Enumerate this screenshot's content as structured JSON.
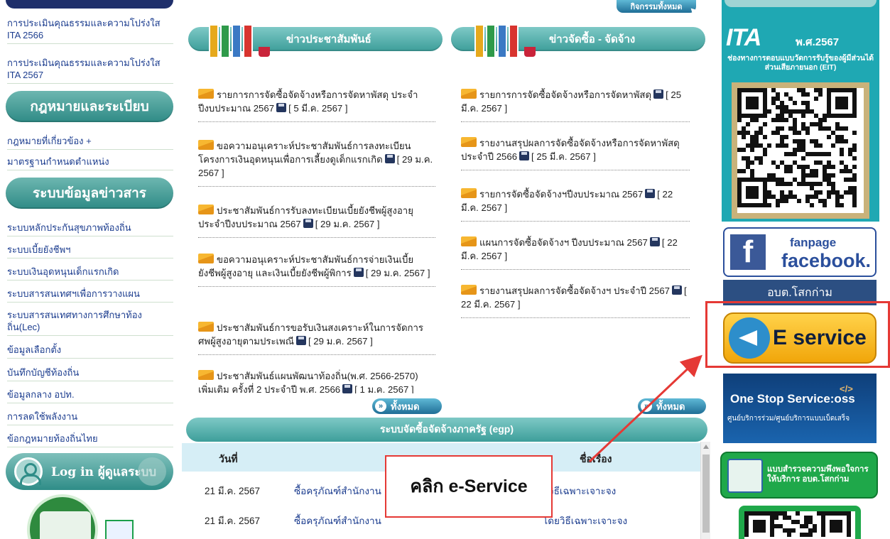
{
  "left": {
    "links_top": [
      "การประเมินคุณธรรมและความโปร่งใส ITA 2566",
      "การประเมินคุณธรรมและความโปร่งใส ITA 2567"
    ],
    "section_law": "กฎหมายและระเบียบ",
    "links_law": [
      "กฎหมายที่เกี่ยวข้อง +",
      "มาตรฐานกำหนดตำแหน่ง"
    ],
    "section_info": "ระบบข้อมูลข่าวสาร",
    "links_info": [
      "ระบบหลักประกันสุขภาพท้องถิ่น",
      "ระบบเบี้ยยังชีพฯ",
      "ระบบเงินอุดหนุนเด็กแรกเกิด",
      "ระบบสารสนเทศฯเพื่อการวางแผน",
      "ระบบสารสนเทศทางการศึกษาท้องถิ่น(Lec)",
      "ข้อมูลเลือกตั้ง",
      "บันทึกบัญชีท้องถิ่น",
      "ข้อมูลกลาง อปท.",
      "การลดใช้พลังงาน",
      "ข้อกฎหมายท้องถิ่นไทย"
    ],
    "login_label": "Log in ผู้ดูแลระบบ"
  },
  "top_pill": "กิจกรรมทั้งหมด",
  "pr": {
    "title": "ข่าวประชาสัมพันธ์",
    "items": [
      {
        "text": "รายการการจัดซื้อจัดจ้างหรือการจัดหาพัสดุ ประจำปีงบประมาณ 2567",
        "date": "[ 5 มี.ค. 2567 ]"
      },
      {
        "text": "ขอความอนุเคราะห์ประชาสัมพันธ์การลงทะเบียนโครงการเงินอุดหนุนเพื่อการเลี้ยงดูเด็กแรกเกิด",
        "date": "[ 29 ม.ค. 2567 ]"
      },
      {
        "text": "ประชาสัมพันธ์การรับลงทะเบียนเบี้ยยังชีพผู้สูงอายุประจำปีงบประมาณ 2567",
        "date": "[ 29 ม.ค. 2567 ]"
      },
      {
        "text": "ขอความอนุเคราะห์ประชาสัมพันธ์การจ่ายเงินเบี้ยยังชีพผู้สูงอายุ และเงินเบี้ยยังชีพผู้พิการ",
        "date": "[ 29 ม.ค. 2567 ]"
      },
      {
        "text": "ประชาสัมพันธ์การขอรับเงินสงเคราะห์ในการจัดการศพผู้สูงอายุตามประเพณี",
        "date": "[ 29 ม.ค. 2567 ]"
      },
      {
        "text": "ประชาสัมพันธ์แผนพัฒนาท้องถิ่น(พ.ศ. 2566-2570) เพิ่มเติม ครั้งที่ 2 ประจำปี พ.ศ. 2566",
        "date": "[ 1 ม.ค. 2567 ]"
      }
    ],
    "all_label": "ทั้งหมด"
  },
  "procure": {
    "title": "ข่าวจัดซื้อ - จัดจ้าง",
    "items": [
      {
        "text": "รายการการจัดซื้อจัดจ้างหรือการจัดหาพัสดุ",
        "date": "[ 25 มี.ค. 2567 ]"
      },
      {
        "text": "รายงานสรุปผลการจัดซื้อจัดจ้างหรือการจัดหาพัสดุ ประจำปี 2566",
        "date": "[ 25 มี.ค. 2567 ]"
      },
      {
        "text": "รายการจัดซื้อจัดจ้างฯปีงบประมาณ 2567",
        "date": "[ 22 มี.ค. 2567 ]"
      },
      {
        "text": "แผนการจัดซื้อจัดจ้างฯ ปีงบประมาณ 2567",
        "date": "[ 22 มี.ค. 2567 ]"
      },
      {
        "text": "รายงานสรุปผลการจัดซื้อจัดจ้างฯ ประจำปี 2567",
        "date": "[ 22 มี.ค. 2567 ]"
      }
    ],
    "all_label": "ทั้งหมด"
  },
  "egp": {
    "title": "ระบบจัดซื้อจัดจ้างภาครัฐ (egp)",
    "col_date": "วันที่",
    "col_title": "ชื่อเรื่อง",
    "rows": [
      {
        "date": "21 มี.ค. 2567",
        "title": "ซื้อครุภัณฑ์สำนักงาน",
        "method": "วิธีเฉพาะเจาะจง"
      },
      {
        "date": "21 มี.ค. 2567",
        "title": "ซื้อครุภัณฑ์สำนักงาน",
        "method": "โดยวิธีเฉพาะเจาะจง"
      }
    ]
  },
  "callout": "คลิก e-Service",
  "right": {
    "ita_logo": "ITA",
    "ita_year": "พ.ศ.2567",
    "ita_sub": "ช่องทางการตอบแบบวัดการรับรู้ของผู้มีส่วนได้ส่วนเสียภายนอก (EIT)",
    "fb_small": "fanpage",
    "fb_big": "facebook.",
    "org_name": "อบต.โสกก่าม",
    "eservice": "E service",
    "oss_title": "One Stop Service:oss",
    "oss_sub": "ศูนย์บริการร่วม/ศูนย์บริการแบบเบ็ดเสร็จ",
    "survey": "แบบสำรวจความพึงพอใจการให้บริการ อบต.โสกก่าม",
    "accent": "#e53935"
  }
}
